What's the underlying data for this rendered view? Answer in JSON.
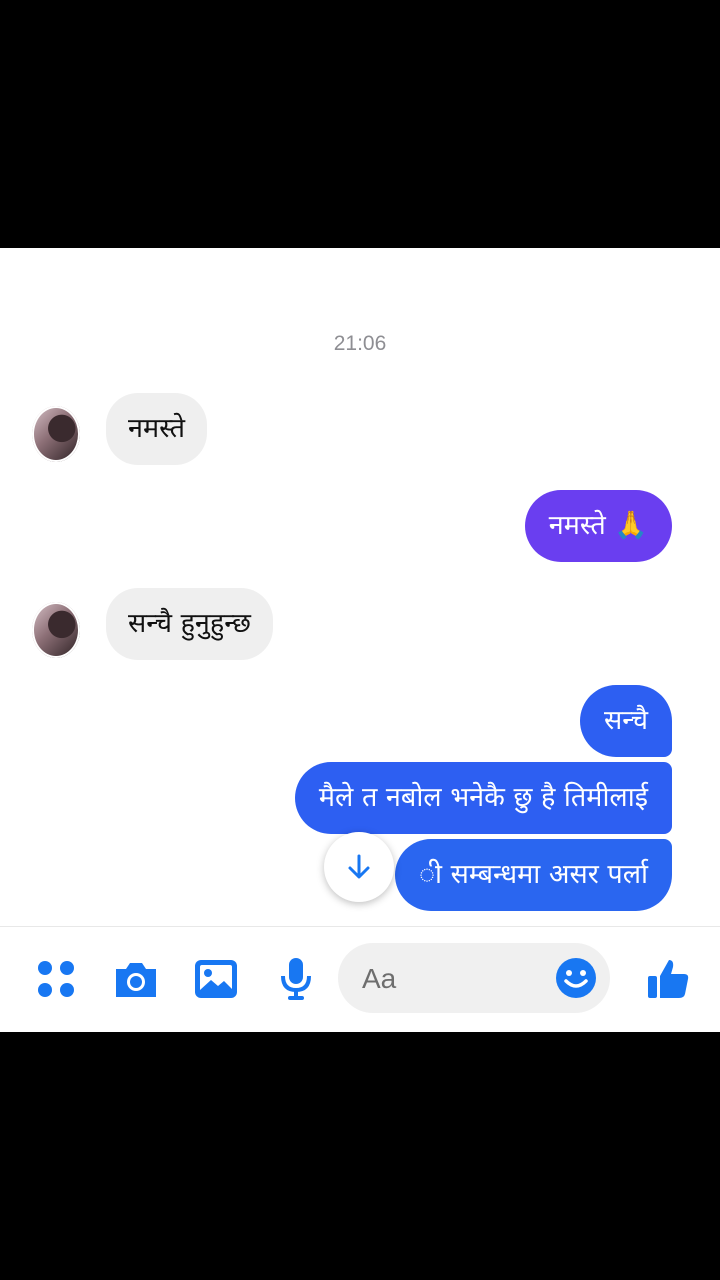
{
  "chat": {
    "timestamp": "21:06",
    "messages": [
      {
        "side": "incoming",
        "text": "नमस्ते"
      },
      {
        "side": "outgoing",
        "text": "नमस्ते 🙏"
      },
      {
        "side": "incoming",
        "text": "सन्चै हुनुहुन्छ"
      },
      {
        "side": "outgoing",
        "text": "सन्चै"
      },
      {
        "side": "outgoing",
        "text": "मैले त नबोल भनेकै छु है तिमीलाई"
      },
      {
        "side": "outgoing",
        "text": "ी सम्बन्धमा असर पर्ला"
      }
    ]
  },
  "composer": {
    "placeholder": "Aa",
    "icons": [
      "apps-icon",
      "camera-icon",
      "gallery-icon",
      "microphone-icon",
      "emoji-icon",
      "like-icon"
    ]
  },
  "colors": {
    "accent": "#1877f2",
    "outgoing_purple": "#6a3ef0",
    "outgoing_blue": "#2d5ff2",
    "incoming_bg": "#efefef"
  }
}
